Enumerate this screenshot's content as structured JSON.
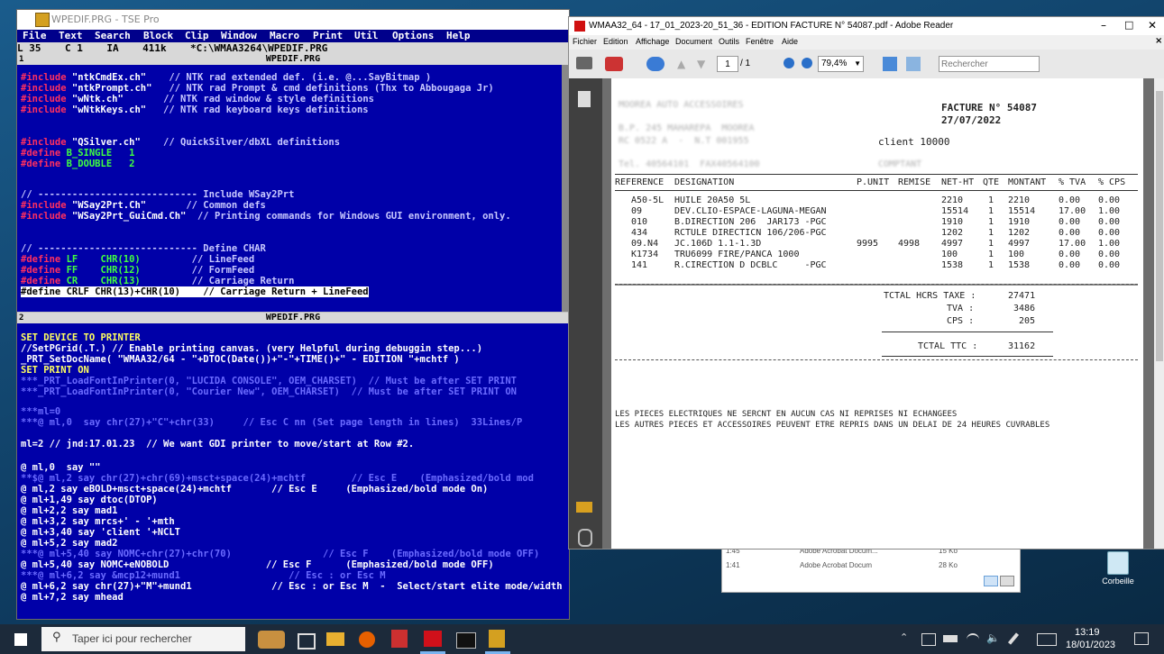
{
  "tse": {
    "title": "WPEDIF.PRG - TSE Pro",
    "menu": [
      "File",
      "Text",
      "Search",
      "Block",
      "Clip",
      "Window",
      "Macro",
      "Print",
      "Util",
      "Options",
      "Help"
    ],
    "status": "L 35    C 1    IA    411k    *C:\\WMAA3264\\WPEDIF.PRG",
    "pane1_title": "WPEDIF.PRG",
    "pane2_title": "WPEDIF.PRG",
    "pane1_num": "1",
    "pane2_num": "2"
  },
  "code1": [
    [
      "#include ",
      "\"ntkCmdEx.ch\"",
      "    // NTK rad extended def. (i.e. @...SayBitmap )"
    ],
    [
      "#include ",
      "\"ntkPrompt.ch\"",
      "   // NTK rad Prompt & cmd definitions (Thx to Abbougaga Jr)"
    ],
    [
      "#include ",
      "\"wNtk.ch\"",
      "       // NTK rad window & style definitions"
    ],
    [
      "#include ",
      "\"wNtkKeys.ch\"",
      "   // NTK rad keyboard keys definitions"
    ],
    [
      "#include ",
      "\"QSilver.ch\"",
      "    // QuickSilver/dbXL definitions"
    ],
    [
      "#define ",
      "B_SINGLE   1",
      ""
    ],
    [
      "#define ",
      "B_DOUBLE   2",
      ""
    ],
    [
      "// ",
      "---------------------------- Include WSay2Prt",
      ""
    ],
    [
      "#include ",
      "\"WSay2Prt.Ch\"",
      "       // Common defs"
    ],
    [
      "#include ",
      "\"WSay2Prt_GuiCmd.Ch\"",
      "  // Printing commands for Windows GUI environment, only."
    ],
    [
      "// ",
      "---------------------------- Define CHAR",
      ""
    ],
    [
      "#define ",
      "LF    CHR(10)",
      "         // LineFeed"
    ],
    [
      "#define ",
      "FF    CHR(12)",
      "         // FormFeed"
    ],
    [
      "#define ",
      "CR    CHR(13)",
      "         // Carriage Return"
    ],
    [
      "#define ",
      "CRLF CHR(13)+CHR(10)",
      "    // Carriage Return + LineFeed"
    ]
  ],
  "code2": [
    "SET DEVICE TO PRINTER",
    "//SetPGrid(.T.) // Enable printing canvas. (very Helpful during debuggin step...)",
    "_PRT_SetDocName( \"WMAA32/64 - \"+DTOC(Date())+\"-\"+TIME()+\" - EDITION \"+mchtf )",
    "SET PRINT ON",
    "***_PRT_LoadFontInPrinter(0, \"LUCIDA CONSOLE\", OEM_CHARSET)  // Must be after SET PRINT",
    "***_PRT_LoadFontInPrinter(0, \"Courier New\", OEM_CHARSET)  // Must be after SET PRINT ON",
    "***ml=0",
    "***@ ml,0  say chr(27)+\"C\"+chr(33)     // Esc C nn (Set page length in lines)  33Lines/P",
    "ml=2 // jnd:17.01.23  // We want GDI printer to move/start at Row #2.",
    "@ ml,0  say \"\"",
    "**$@ ml,2 say chr(27)+chr(69)+msct+space(24)+mchtf        // Esc E    (Emphasized/bold mod",
    "@ ml,2 say eBOLD+msct+space(24)+mchtf       // Esc E     (Emphasized/bold mode On)",
    "@ ml+1,49 say dtoc(DTOP)",
    "@ ml+2,2 say mad1",
    "@ ml+3,2 say mrcs+' - '+mth",
    "@ ml+3,40 say 'client '+NCLT",
    "@ ml+5,2 say mad2",
    "***@ ml+5,40 say NOMC+chr(27)+chr(70)                // Esc F    (Emphasized/bold mode OFF)",
    "@ ml+5,40 say NOMC+eNOBOLD                 // Esc F      (Emphasized/bold mode OFF)",
    "***@ ml+6,2 say &mcp12+mund1                   // Esc : or Esc M",
    "@ ml+6,2 say chr(27)+\"M\"+mund1              // Esc : or Esc M  -  Select/start elite mode/width (12 cpi)",
    "@ ml+7,2 say mhead"
  ],
  "pdf": {
    "title": "WMAA32_64 - 17_01_2023-20_51_36 - EDITION FACTURE N° 54087.pdf - Adobe Reader",
    "menu": [
      "Fichier",
      "Edition",
      "Affichage",
      "Document",
      "Outils",
      "Fenêtre",
      "Aide"
    ],
    "page_current": "1",
    "page_total": "/ 1",
    "zoom": "79,4%",
    "search_placeholder": "Rechercher"
  },
  "invoice": {
    "company_line1": "MOOREA AUTO ACCESSOIRES",
    "company_line2": "B.P. 245 MAHAREPA  MOOREA",
    "company_line3": "RC 0522 A  -  N.T 001955",
    "company_line4": "Tel. 40564101  FAX40564100",
    "facture": "FACTURE N° 54087",
    "date": "27/07/2022",
    "client": "client 10000",
    "comptant": "COMPTANT",
    "headers": [
      "REFERENCE",
      "DESIGNATION",
      "P.UNIT",
      "REMISE",
      "NET-HT",
      "QTE",
      "MONTANT",
      "% TVA",
      "% CPS"
    ],
    "rows": [
      [
        "A50-5L",
        "HUILE 20A50 5L",
        "",
        "",
        "2210",
        "1",
        "2210",
        "0.00",
        "0.00"
      ],
      [
        "09",
        "DEV.CLIO-ESPACE-LAGUNA-MEGAN",
        "",
        "",
        "15514",
        "1",
        "15514",
        "17.00",
        "1.00"
      ],
      [
        "010",
        "B.DIRECTION 206  JAR173 -PGC",
        "",
        "",
        "1910",
        "1",
        "1910",
        "0.00",
        "0.00"
      ],
      [
        "434",
        "RCTULE DIRECTICN 106/206-PGC",
        "",
        "",
        "1202",
        "1",
        "1202",
        "0.00",
        "0.00"
      ],
      [
        "09.N4",
        "JC.106D 1.1-1.3D",
        "9995",
        "4998",
        "4997",
        "1",
        "4997",
        "17.00",
        "1.00"
      ],
      [
        "K1734",
        "TRU6099 FIRE/PANCA 1000",
        "",
        "",
        "100",
        "1",
        "100",
        "0.00",
        "0.00"
      ],
      [
        "141",
        "R.CIRECTION D DCBLC     -PGC",
        "",
        "",
        "1538",
        "1",
        "1538",
        "0.00",
        "0.00"
      ]
    ],
    "total_ht_label": "TCTAL HCRS TAXE :",
    "total_ht": "27471",
    "tva_label": "TVA :",
    "tva": "3486",
    "cps_label": "CPS :",
    "cps": "205",
    "ttc_label": "TCTAL TTC :",
    "ttc": "31162",
    "note1": "LES PIECES ELECTRIQUES NE SERCNT EN AUCUN CAS NI REPRISES NI ECHANGEES",
    "note2": "LES AUTRES PIECES ET ACCESSOIRES PEUVENT ETRE REPRIS DANS UN DELAI DE 24 HEURES CUVRABLES"
  },
  "explorer_rows": [
    [
      "1:45",
      "Adobe Acrobat Docum...",
      "15 Ko"
    ],
    [
      "1:41",
      "Adobe Acrobat Docum",
      "28 Ko"
    ]
  ],
  "desktop": {
    "corbeille": "Corbeille"
  },
  "taskbar": {
    "search_placeholder": "Taper ici pour rechercher",
    "time": "13:19",
    "date": "18/01/2023"
  },
  "colors": {
    "tse_bg": "#0000a8",
    "menu_bg": "#00008b",
    "taskbar": "#1c2a3a"
  }
}
